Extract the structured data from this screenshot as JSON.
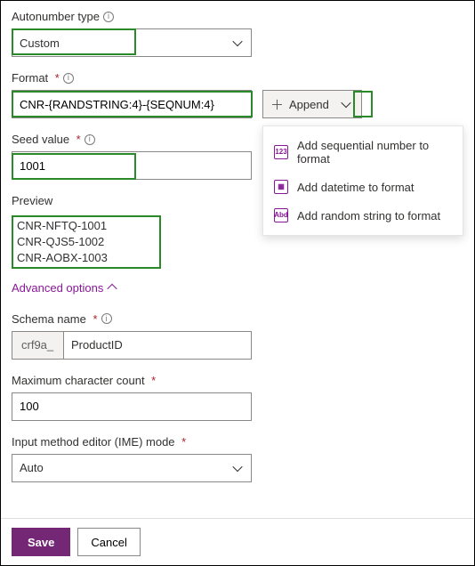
{
  "autonumber": {
    "label": "Autonumber type",
    "value": "Custom"
  },
  "format": {
    "label": "Format",
    "value": "CNR-{RANDSTRING:4}-{SEQNUM:4}",
    "append_label": "Append"
  },
  "seed": {
    "label": "Seed value",
    "value": "1001"
  },
  "preview": {
    "label": "Preview",
    "lines": [
      "CNR-NFTQ-1001",
      "CNR-QJS5-1002",
      "CNR-AOBX-1003"
    ]
  },
  "advanced_label": "Advanced options",
  "schema": {
    "label": "Schema name",
    "prefix": "crf9a_",
    "value": "ProductID"
  },
  "maxcount": {
    "label": "Maximum character count",
    "value": "100"
  },
  "ime": {
    "label": "Input method editor (IME) mode",
    "value": "Auto"
  },
  "menu": {
    "items": [
      {
        "icon": "123",
        "label": "Add sequential number to format"
      },
      {
        "icon": "📅",
        "label": "Add datetime to format"
      },
      {
        "icon": "Abd",
        "label": "Add random string to format"
      }
    ]
  },
  "footer": {
    "save": "Save",
    "cancel": "Cancel"
  }
}
